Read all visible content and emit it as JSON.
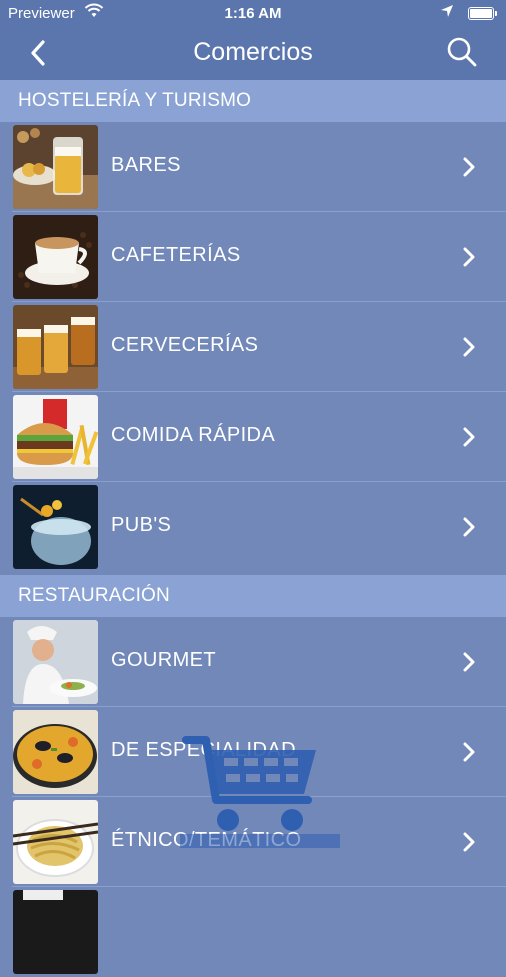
{
  "status": {
    "carrier": "Previewer",
    "time": "1:16 AM"
  },
  "nav": {
    "title": "Comercios"
  },
  "sections": [
    {
      "title": "HOSTELERÍA Y TURISMO",
      "items": [
        "BARES",
        "CAFETERÍAS",
        "CERVECERÍAS",
        "COMIDA RÁPIDA",
        "PUB'S"
      ]
    },
    {
      "title": "RESTAURACIÓN",
      "items": [
        "GOURMET",
        "DE ESPECIALIDAD",
        "ÉTNICO/TEMÁTICO"
      ]
    }
  ],
  "colors": {
    "background": "#7288b8",
    "navbar": "#5a76ad",
    "section_header": "#8aa3d4"
  }
}
